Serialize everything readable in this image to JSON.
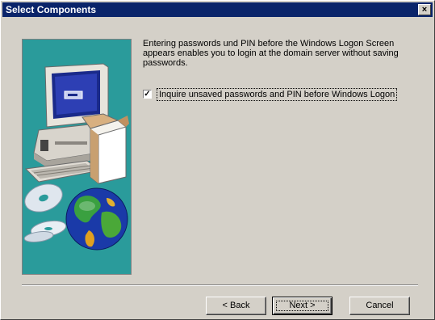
{
  "window": {
    "title": "Select Components",
    "close_glyph": "×"
  },
  "content": {
    "description": "Entering passwords und PIN before the Windows Logon Screen appears enables you to login at the domain server without saving passwords.",
    "checkbox": {
      "label": "Inquire unsaved passwords and PIN before Windows Logon",
      "checked": true,
      "check_glyph": "✓"
    }
  },
  "buttons": {
    "back_label": "< Back",
    "next_label": "Next >",
    "cancel_label": "Cancel"
  },
  "illustration": {
    "icons": [
      "computer-icon",
      "box-icon",
      "cd-icon",
      "globe-icon"
    ],
    "background_color": "#2a9b9b"
  },
  "colors": {
    "titlebar": "#0a246a",
    "dialog_face": "#d4d0c8"
  }
}
